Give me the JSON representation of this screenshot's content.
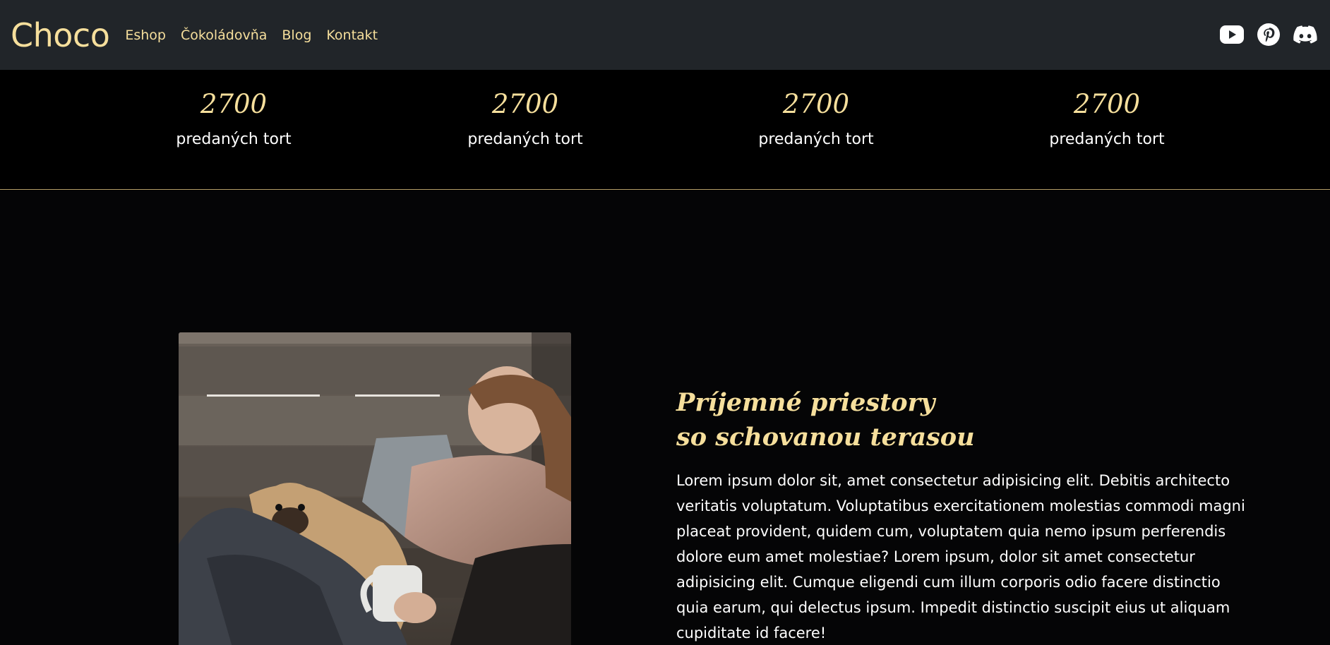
{
  "navbar": {
    "brand": "Choco",
    "links": [
      "Eshop",
      "Čokoládovňa",
      "Blog",
      "Kontakt"
    ],
    "social": [
      "youtube-icon",
      "pinterest-icon",
      "discord-icon"
    ]
  },
  "stats": [
    {
      "number": "2700",
      "label": "predaných tort"
    },
    {
      "number": "2700",
      "label": "predaných tort"
    },
    {
      "number": "2700",
      "label": "predaných tort"
    },
    {
      "number": "2700",
      "label": "predaných tort"
    }
  ],
  "feature": {
    "title_line1": "Príjemné priestory",
    "title_line2": "so schovanou terasou",
    "text": "Lorem ipsum dolor sit, amet consectetur adipisicing elit. Debitis architecto veritatis voluptatum. Voluptatibus exercitationem molestias commodi magni placeat provident, quidem cum, voluptatem quia nemo ipsum perferendis dolore eum amet molestiae? Lorem ipsum, dolor sit amet consectetur adipisicing elit. Cumque eligendi cum illum corporis odio facere distinctio quia earum, qui delectus ipsum. Impedit distinctio suscipit eius ut aliquam cupiditate id facere!",
    "image": "woman-with-pug-photo"
  },
  "colors": {
    "navbar_bg": "#212529",
    "accent_gold": "#f6df9c",
    "page_bg": "#000000"
  }
}
